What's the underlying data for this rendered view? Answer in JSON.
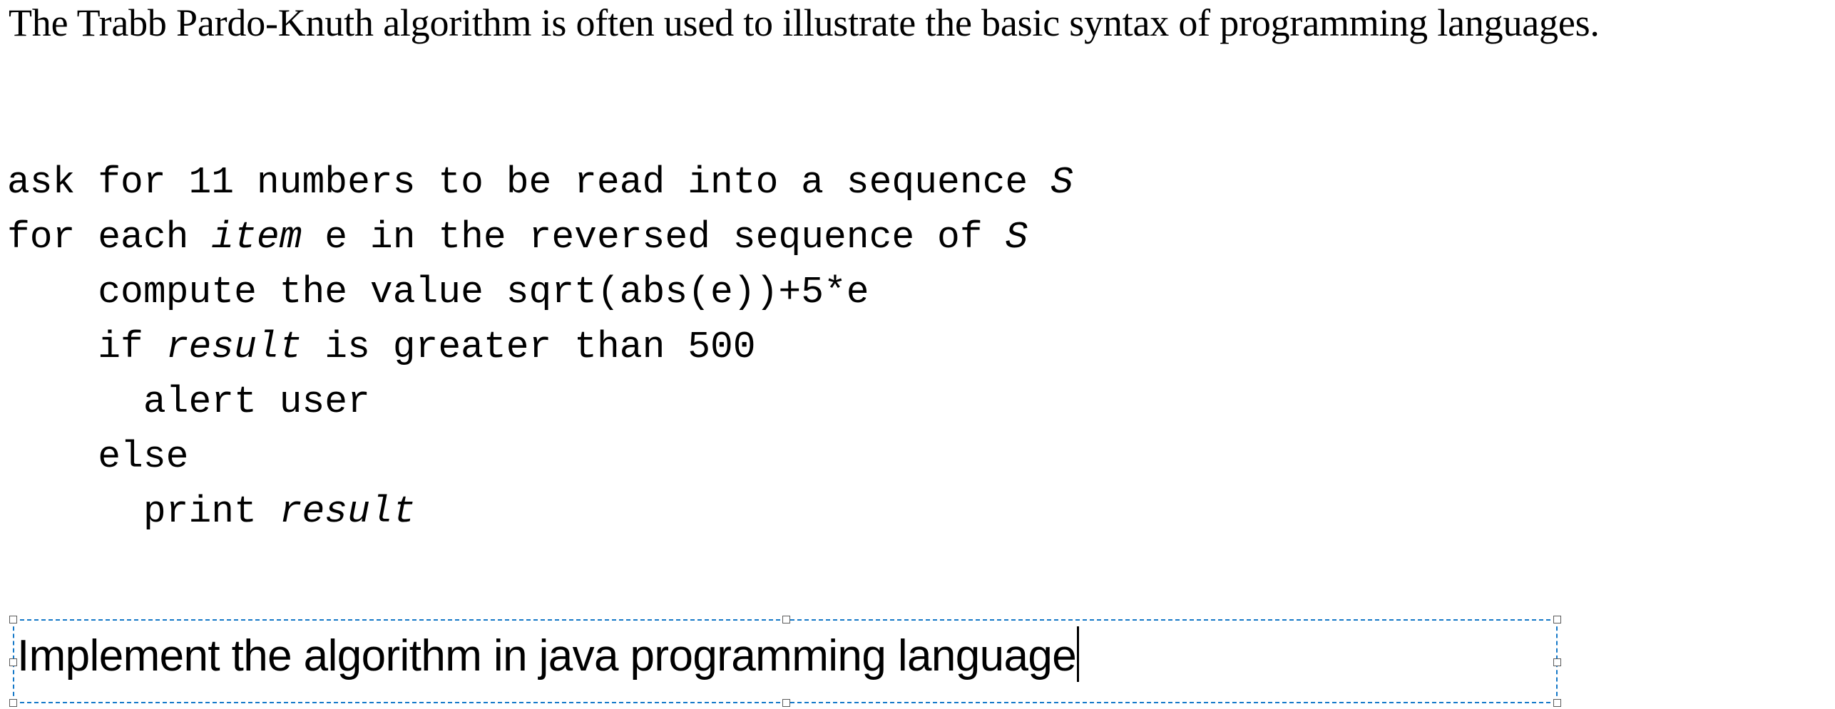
{
  "document": {
    "intro_paragraph": "The Trabb Pardo-Knuth algorithm is often used to illustrate the basic syntax of programming languages.",
    "pseudocode": {
      "lines": [
        {
          "indent": "",
          "segments": [
            {
              "text": "ask for 11 numbers to be read into a sequence ",
              "italic": false
            },
            {
              "text": "S",
              "italic": true
            }
          ]
        },
        {
          "indent": "",
          "segments": [
            {
              "text": "for each ",
              "italic": false
            },
            {
              "text": "item",
              "italic": true
            },
            {
              "text": " e in the reversed sequence of ",
              "italic": false
            },
            {
              "text": "S",
              "italic": true
            }
          ]
        },
        {
          "indent": "    ",
          "segments": [
            {
              "text": "compute the value sqrt(abs(e))+5*e",
              "italic": false
            }
          ]
        },
        {
          "indent": "    ",
          "segments": [
            {
              "text": "if ",
              "italic": false
            },
            {
              "text": "result",
              "italic": true
            },
            {
              "text": " is greater than 500",
              "italic": false
            }
          ]
        },
        {
          "indent": "      ",
          "segments": [
            {
              "text": "alert user",
              "italic": false
            }
          ]
        },
        {
          "indent": "    ",
          "segments": [
            {
              "text": "else",
              "italic": false
            }
          ]
        },
        {
          "indent": "      ",
          "segments": [
            {
              "text": "print ",
              "italic": false
            },
            {
              "text": "result",
              "italic": true
            }
          ]
        }
      ]
    }
  },
  "textbox": {
    "value": "Implement the algorithm in java programming language",
    "placeholder": "",
    "selected": true,
    "caret_visible": true,
    "border_color": "#1478c8",
    "handle_fill": "#ffffff",
    "handle_border": "#5a5a5a"
  },
  "colors": {
    "page_background": "#ffffff",
    "text": "#000000",
    "selection_blue": "#1478c8"
  }
}
